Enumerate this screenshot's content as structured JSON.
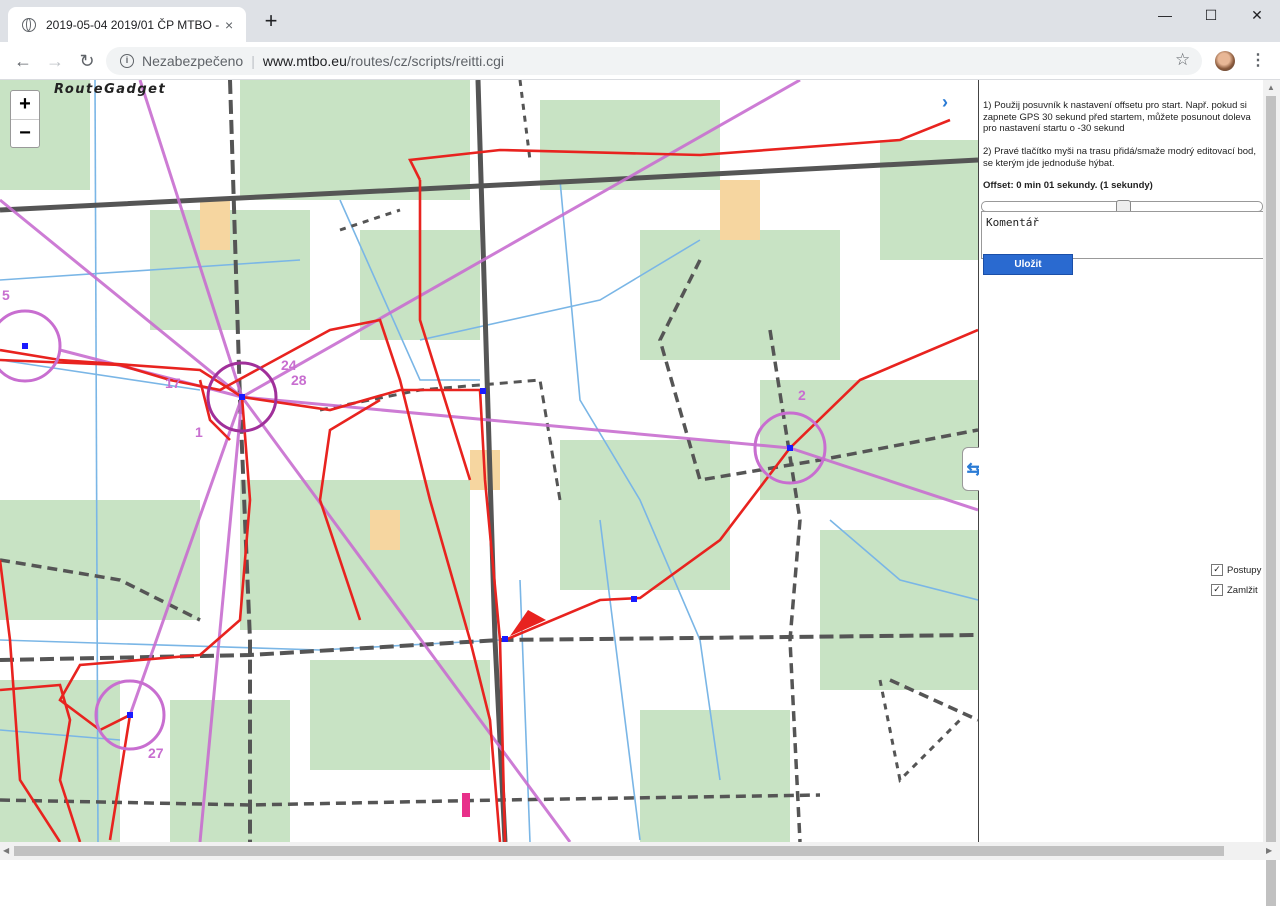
{
  "browser": {
    "tab_title": "2019-05-04 2019/01 ČP MTBO -",
    "tab_close": "×",
    "new_tab": "+",
    "minimize": "—",
    "maximize": "☐",
    "close": "✕",
    "back": "←",
    "forward": "→",
    "reload": "↻",
    "insecure_label": "Nezabezpečeno",
    "url_host": "www.mtbo.eu",
    "url_path": "/routes/cz/scripts/reitti.cgi",
    "bookmark": "☆",
    "menu": "⋮"
  },
  "map": {
    "logo": "RouteGadget",
    "zoom_in": "+",
    "zoom_out": "−",
    "control_labels": [
      "5",
      "17",
      "24",
      "28",
      "1",
      "2",
      "27"
    ],
    "colors": {
      "route": "#e8231f",
      "course": "#c86ed0",
      "control": "#a040a8",
      "road": "#555555",
      "water": "#7ab6e6",
      "vegetation": "#c8e3c4",
      "open": "#f6d6a0"
    },
    "collapse_icon": "⇆",
    "top_right_arrow": "›"
  },
  "panel": {
    "instruction_1": "1) Použij posuvník k nastavení offsetu pro start. Např. pokud si zapnete GPS 30 sekund před startem, můžete posunout doleva pro nastavení startu o -30 sekund",
    "instruction_2": "2) Pravé tlačítko myši na trasu přidá/smaže modrý editovací bod, se kterým jde jednoduše hýbat.",
    "offset_text": "Offset: 0 min 01 sekundy. (1 sekundy)",
    "offset_value": 0.5,
    "comment_value": "Komentář",
    "save_label": "Uložit",
    "checkbox_1": "Postupy",
    "checkbox_2": "Zamlžit",
    "check_mark": "✓"
  }
}
